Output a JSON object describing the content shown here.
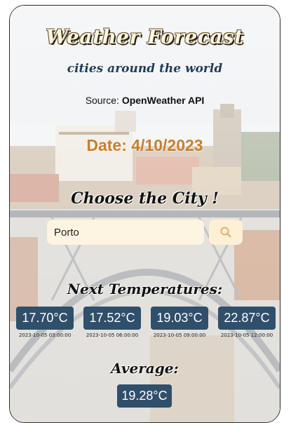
{
  "header": {
    "title": "Weather Forecast",
    "subtitle": "cities around the world",
    "source_prefix": "Source: ",
    "source_name": "OpenWeather API"
  },
  "date_text": "Date: 4/10/2023",
  "search": {
    "heading": "Choose the City !",
    "value": "Porto",
    "button_icon": "search-icon"
  },
  "forecast": {
    "heading": "Next Temperatures:",
    "items": [
      {
        "temp": "17.70°C",
        "time": "2023-10-05 03:00:00"
      },
      {
        "temp": "17.52°C",
        "time": "2023-10-05 06:00:00"
      },
      {
        "temp": "19.03°C",
        "time": "2023-10-05 09:00:00"
      },
      {
        "temp": "22.87°C",
        "time": "2023-10-05 12:00:00"
      }
    ]
  },
  "average": {
    "heading": "Average:",
    "value": "19.28°C"
  },
  "colors": {
    "badge": "#2f4f6b",
    "date": "#c87f2d",
    "input_bg": "#fdf5e1"
  }
}
